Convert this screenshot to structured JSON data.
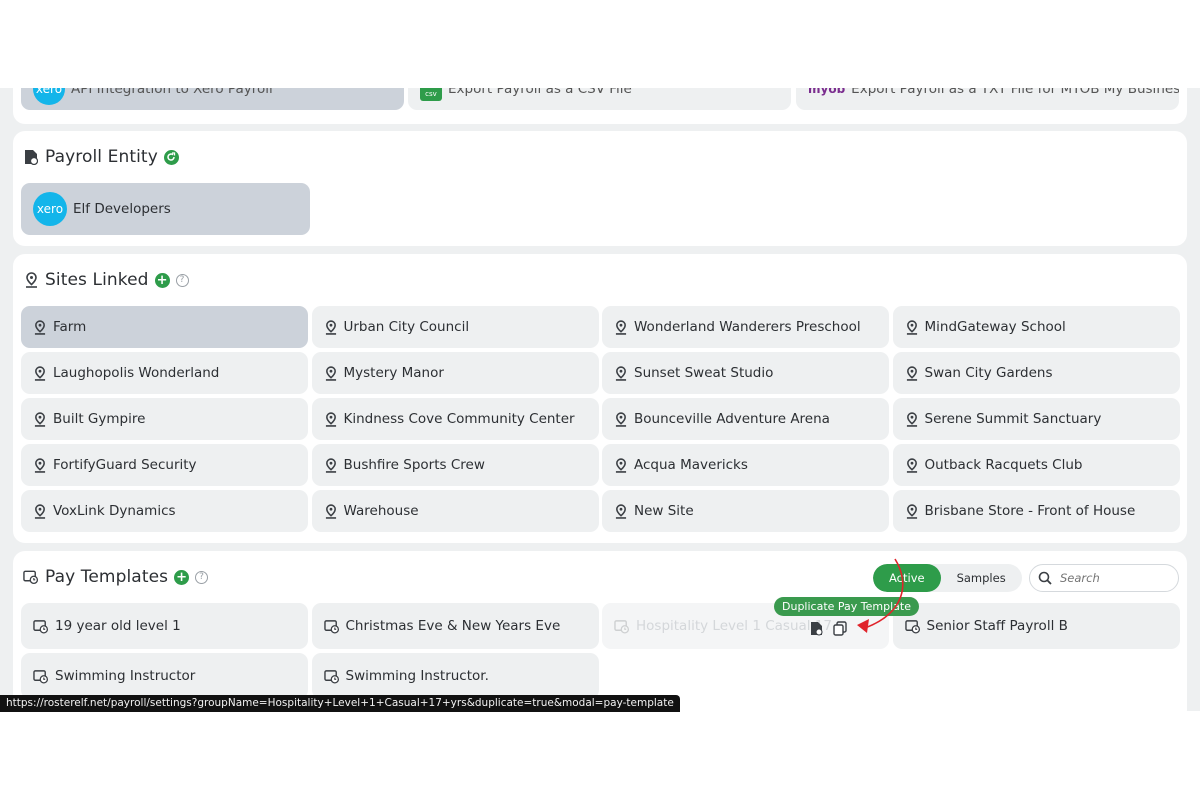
{
  "integrations": {
    "items": [
      {
        "label": "API Integration to Xero Payroll",
        "badge": "xero"
      },
      {
        "label": "Export Payroll as a CSV File",
        "badge": "csv"
      },
      {
        "label": "Export Payroll as a TXT File for MYOB My Business",
        "badge": "myob"
      }
    ]
  },
  "payroll_entity": {
    "title": "Payroll Entity",
    "items": [
      {
        "label": "Elf Developers",
        "badge": "xero"
      }
    ]
  },
  "sites": {
    "title": "Sites Linked",
    "items": [
      "Farm",
      "Urban City Council",
      "Wonderland Wanderers Preschool",
      "MindGateway School",
      "Laughopolis Wonderland",
      "Mystery Manor",
      "Sunset Sweat Studio",
      "Swan City Gardens",
      "Built Gympire",
      "Kindness Cove Community Center",
      "Bounceville Adventure Arena",
      "Serene Summit Sanctuary",
      "FortifyGuard Security",
      "Bushfire Sports Crew",
      "Acqua Mavericks",
      "Outback Racquets Club",
      "VoxLink Dynamics",
      "Warehouse",
      "New Site",
      "Brisbane Store - Front of House"
    ]
  },
  "pay_templates": {
    "title": "Pay Templates",
    "toggle": {
      "active": "Active",
      "samples": "Samples"
    },
    "search_placeholder": "Search",
    "items": [
      "19 year old level 1",
      "Christmas Eve & New Years Eve",
      "Hospitality Level 1 Casual 17+",
      "Senior Staff Payroll B",
      "Swimming Instructor",
      "Swimming Instructor."
    ],
    "tooltip": "Duplicate Pay Template"
  },
  "status_url": "https://rosterelf.net/payroll/settings?groupName=Hospitality+Level+1+Casual+17+yrs&duplicate=true&modal=pay-template",
  "colors": {
    "accent": "#2e9c4a",
    "xero": "#13b5ea",
    "annotation": "#e0242b"
  }
}
